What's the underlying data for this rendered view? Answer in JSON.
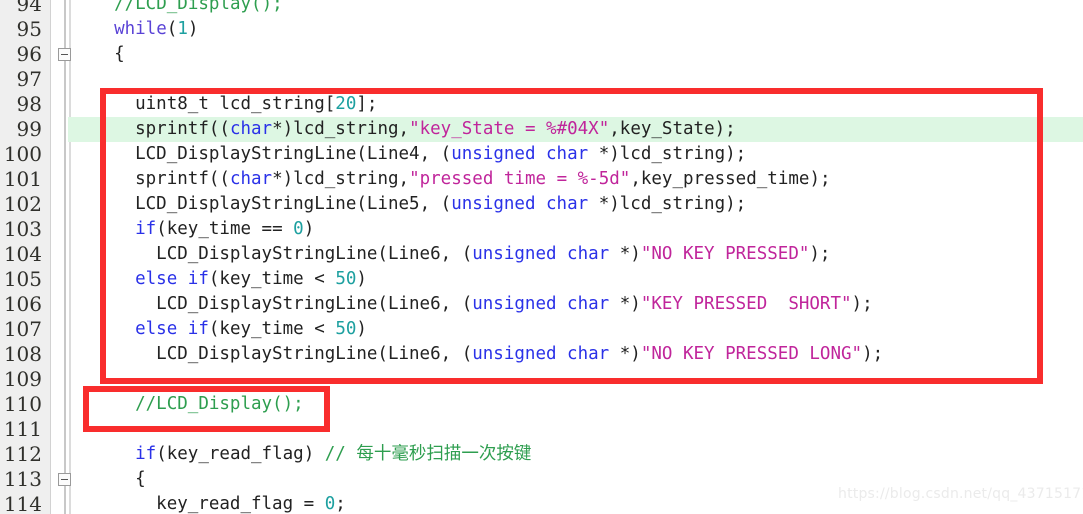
{
  "editor": {
    "language": "C",
    "first_visible_line": 94,
    "last_visible_line": 114,
    "highlighted_line": 99,
    "colors": {
      "background": "#ffffff",
      "gutter_background": "#efefef",
      "line_number": "#30302c",
      "text": "#222222",
      "keyword": "#2a31e8",
      "keyword_alt": "#5a43d6",
      "number": "#1da0a0",
      "string": "#c0259b",
      "comment": "#2e9e4f",
      "current_line_highlight": "#ddf7e3",
      "annotation_box": "#f92d2d"
    }
  },
  "lines": [
    {
      "number": "94",
      "indent": 4,
      "fold": false,
      "highlight": false,
      "tokens": [
        {
          "t": "//LCD_Display();",
          "c": "cmt"
        }
      ]
    },
    {
      "number": "95",
      "indent": 4,
      "fold": false,
      "highlight": false,
      "tokens": [
        {
          "t": "while",
          "c": "kw2"
        },
        {
          "t": "(",
          "c": "pl"
        },
        {
          "t": "1",
          "c": "num"
        },
        {
          "t": ")",
          "c": "pl"
        }
      ]
    },
    {
      "number": "96",
      "indent": 4,
      "fold": true,
      "highlight": false,
      "tokens": [
        {
          "t": "{",
          "c": "pl"
        }
      ]
    },
    {
      "number": "97",
      "indent": 0,
      "fold": false,
      "highlight": false,
      "tokens": []
    },
    {
      "number": "98",
      "indent": 6,
      "fold": false,
      "highlight": false,
      "tokens": [
        {
          "t": "uint8_t lcd_string[",
          "c": "pl"
        },
        {
          "t": "20",
          "c": "num"
        },
        {
          "t": "];",
          "c": "pl"
        }
      ]
    },
    {
      "number": "99",
      "indent": 6,
      "fold": false,
      "highlight": true,
      "tokens": [
        {
          "t": "sprintf((",
          "c": "pl"
        },
        {
          "t": "char",
          "c": "kw"
        },
        {
          "t": "*)lcd_string,",
          "c": "pl"
        },
        {
          "t": "\"key_State = %#04X\"",
          "c": "str"
        },
        {
          "t": ",key_State);",
          "c": "pl"
        }
      ]
    },
    {
      "number": "100",
      "indent": 6,
      "fold": false,
      "highlight": false,
      "tokens": [
        {
          "t": "LCD_DisplayStringLine(Line4, (",
          "c": "pl"
        },
        {
          "t": "unsigned char",
          "c": "kw"
        },
        {
          "t": " *)lcd_string);",
          "c": "pl"
        }
      ]
    },
    {
      "number": "101",
      "indent": 6,
      "fold": false,
      "highlight": false,
      "tokens": [
        {
          "t": "sprintf((",
          "c": "pl"
        },
        {
          "t": "char",
          "c": "kw"
        },
        {
          "t": "*)lcd_string,",
          "c": "pl"
        },
        {
          "t": "\"pressed time = %-5d\"",
          "c": "str"
        },
        {
          "t": ",key_pressed_time);",
          "c": "pl"
        }
      ]
    },
    {
      "number": "102",
      "indent": 6,
      "fold": false,
      "highlight": false,
      "tokens": [
        {
          "t": "LCD_DisplayStringLine(Line5, (",
          "c": "pl"
        },
        {
          "t": "unsigned char",
          "c": "kw"
        },
        {
          "t": " *)lcd_string);",
          "c": "pl"
        }
      ]
    },
    {
      "number": "103",
      "indent": 6,
      "fold": false,
      "highlight": false,
      "tokens": [
        {
          "t": "if",
          "c": "kw"
        },
        {
          "t": "(key_time == ",
          "c": "pl"
        },
        {
          "t": "0",
          "c": "num"
        },
        {
          "t": ")",
          "c": "pl"
        }
      ]
    },
    {
      "number": "104",
      "indent": 8,
      "fold": false,
      "highlight": false,
      "tokens": [
        {
          "t": "LCD_DisplayStringLine(Line6, (",
          "c": "pl"
        },
        {
          "t": "unsigned char",
          "c": "kw"
        },
        {
          "t": " *)",
          "c": "pl"
        },
        {
          "t": "\"NO KEY PRESSED\"",
          "c": "str"
        },
        {
          "t": ");",
          "c": "pl"
        }
      ]
    },
    {
      "number": "105",
      "indent": 6,
      "fold": false,
      "highlight": false,
      "tokens": [
        {
          "t": "else if",
          "c": "kw"
        },
        {
          "t": "(key_time < ",
          "c": "pl"
        },
        {
          "t": "50",
          "c": "num"
        },
        {
          "t": ")",
          "c": "pl"
        }
      ]
    },
    {
      "number": "106",
      "indent": 8,
      "fold": false,
      "highlight": false,
      "tokens": [
        {
          "t": "LCD_DisplayStringLine(Line6, (",
          "c": "pl"
        },
        {
          "t": "unsigned char",
          "c": "kw"
        },
        {
          "t": " *)",
          "c": "pl"
        },
        {
          "t": "\"KEY PRESSED  SHORT\"",
          "c": "str"
        },
        {
          "t": ");",
          "c": "pl"
        }
      ]
    },
    {
      "number": "107",
      "indent": 6,
      "fold": false,
      "highlight": false,
      "tokens": [
        {
          "t": "else if",
          "c": "kw"
        },
        {
          "t": "(key_time < ",
          "c": "pl"
        },
        {
          "t": "50",
          "c": "num"
        },
        {
          "t": ")",
          "c": "pl"
        }
      ]
    },
    {
      "number": "108",
      "indent": 8,
      "fold": false,
      "highlight": false,
      "tokens": [
        {
          "t": "LCD_DisplayStringLine(Line6, (",
          "c": "pl"
        },
        {
          "t": "unsigned char",
          "c": "kw"
        },
        {
          "t": " *)",
          "c": "pl"
        },
        {
          "t": "\"NO KEY PRESSED LONG\"",
          "c": "str"
        },
        {
          "t": ");",
          "c": "pl"
        }
      ]
    },
    {
      "number": "109",
      "indent": 0,
      "fold": false,
      "highlight": false,
      "tokens": []
    },
    {
      "number": "110",
      "indent": 6,
      "fold": false,
      "highlight": false,
      "tokens": [
        {
          "t": "//LCD_Display();",
          "c": "cmt"
        }
      ]
    },
    {
      "number": "111",
      "indent": 0,
      "fold": false,
      "highlight": false,
      "tokens": []
    },
    {
      "number": "112",
      "indent": 6,
      "fold": false,
      "highlight": false,
      "tokens": [
        {
          "t": "if",
          "c": "kw"
        },
        {
          "t": "(key_read_flag) ",
          "c": "pl"
        },
        {
          "t": "// ",
          "c": "cmt"
        },
        {
          "t": "每十毫秒扫描一次按键",
          "c": "cn"
        }
      ]
    },
    {
      "number": "113",
      "indent": 6,
      "fold": true,
      "highlight": false,
      "tokens": [
        {
          "t": "{",
          "c": "pl"
        }
      ]
    },
    {
      "number": "114",
      "indent": 8,
      "fold": false,
      "highlight": false,
      "tokens": [
        {
          "t": "key_read_flag = ",
          "c": "pl"
        },
        {
          "t": "0",
          "c": "num"
        },
        {
          "t": ";",
          "c": "pl"
        }
      ]
    }
  ],
  "annotations": [
    {
      "id": "redbox-main",
      "label": "red-highlight-box-lcd-block",
      "covers_lines": "98-108",
      "color": "#f92d2d"
    },
    {
      "id": "redbox-lower",
      "label": "red-highlight-box-lcd-display-comment",
      "covers_lines": "110",
      "color": "#f92d2d"
    }
  ],
  "watermark": {
    "text": "https://blog.csdn.net/qq_43715171"
  }
}
